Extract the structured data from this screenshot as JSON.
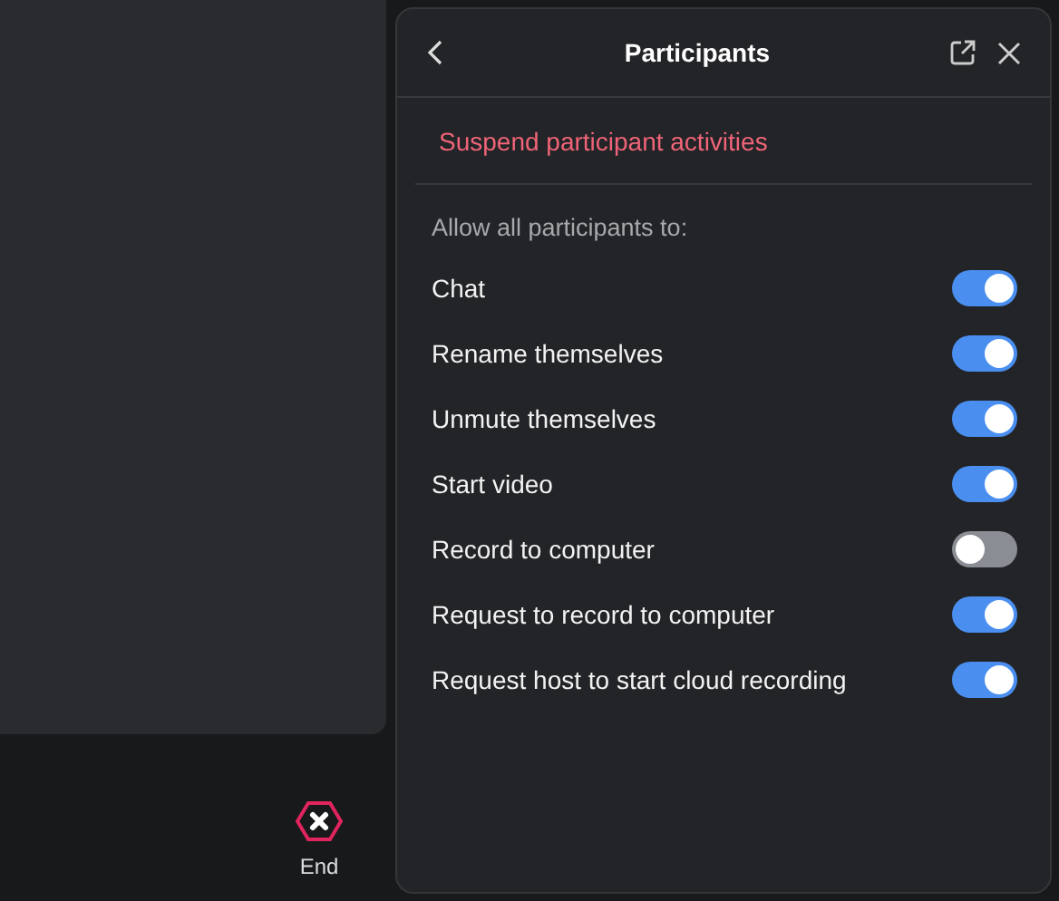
{
  "toolbar": {
    "end_button": {
      "label": "End"
    }
  },
  "panel": {
    "title": "Participants",
    "suspend_link": "Suspend participant activities",
    "section_label": "Allow all participants to:",
    "permissions": [
      {
        "label": "Chat",
        "on": true
      },
      {
        "label": "Rename themselves",
        "on": true
      },
      {
        "label": "Unmute themselves",
        "on": true
      },
      {
        "label": "Start video",
        "on": true
      },
      {
        "label": "Record to computer",
        "on": false
      },
      {
        "label": "Request to record to computer",
        "on": true
      },
      {
        "label": "Request host to start cloud recording",
        "on": true
      }
    ]
  }
}
